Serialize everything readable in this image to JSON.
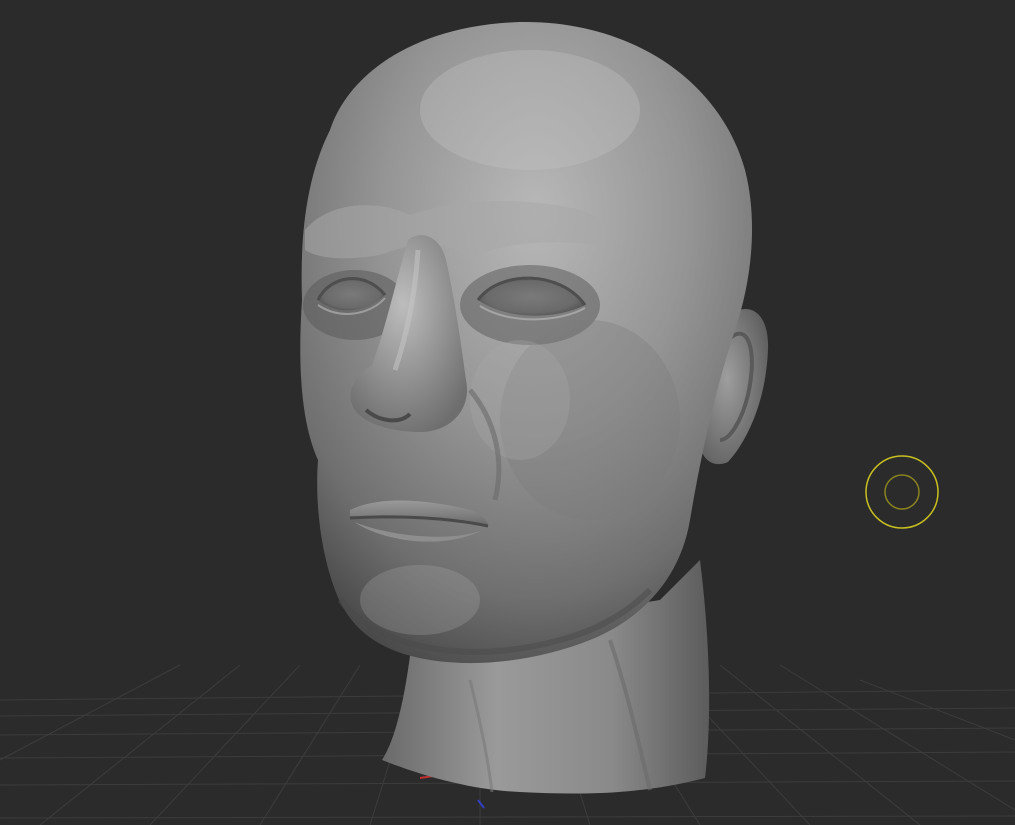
{
  "canvas": {
    "background": "#2b2b2b",
    "grid_color": "#3c3c3c",
    "mesh_base_color": "#8c8c8c",
    "mesh_highlight_color": "#b4b4b4",
    "mesh_shadow_color": "#4e4e4e"
  },
  "model": {
    "icon": "sculpted-head-mesh"
  },
  "brush_cursor": {
    "icon": "brush-cursor-ring-icon",
    "color": "#c8c020"
  },
  "axis_gizmo": {
    "x_color": "#c03030",
    "z_color": "#3040c0"
  }
}
